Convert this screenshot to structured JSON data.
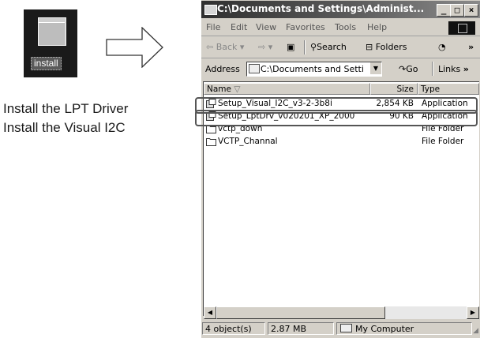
{
  "desktop_icon": {
    "label": "install"
  },
  "captions": [
    "Install the LPT Driver",
    "Install the Visual I2C"
  ],
  "window": {
    "title": "C:\\Documents and Settings\\Administ...",
    "title_buttons": [
      "_",
      "□",
      "×"
    ],
    "menu": [
      "File",
      "Edit",
      "View",
      "Favorites",
      "Tools",
      "Help"
    ],
    "toolbar": {
      "back": "Back",
      "search": "Search",
      "folders": "Folders"
    },
    "address": {
      "label": "Address",
      "value": "C:\\Documents and Setti",
      "go": "Go",
      "links": "Links"
    },
    "columns": {
      "name": "Name",
      "size": "Size",
      "type": "Type"
    },
    "files": [
      {
        "name": "Setup_Visual_I2C_v3-2-3b8i",
        "size": "2,854 KB",
        "type": "Application",
        "icon": "setup-icon"
      },
      {
        "name": "Setup_LptDrv_v020201_XP_2000",
        "size": "90 KB",
        "type": "Application",
        "icon": "setup-icon"
      },
      {
        "name": "vctp_down",
        "size": "",
        "type": "File Folder",
        "icon": "folder-icon"
      },
      {
        "name": "VCTP_Channal",
        "size": "",
        "type": "File Folder",
        "icon": "folder-icon"
      }
    ],
    "status": {
      "objects": "4 object(s)",
      "size": "2.87 MB",
      "location": "My Computer"
    }
  }
}
